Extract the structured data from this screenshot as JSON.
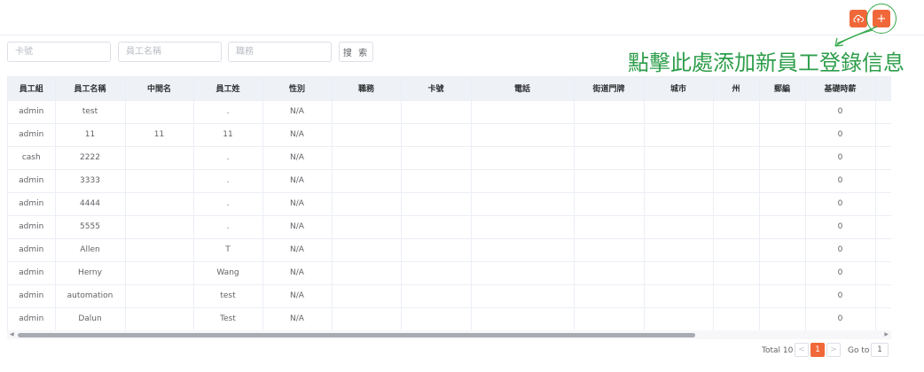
{
  "toolbar": {
    "upload_icon": "cloud-upload-icon",
    "add_label": "+",
    "accent": "#f0683a"
  },
  "annotation": {
    "text": "點擊此處添加新員工登錄信息",
    "color": "#2e9e4b"
  },
  "filters": {
    "card_placeholder": "卡號",
    "name_placeholder": "員工名稱",
    "job_placeholder": "職務",
    "search_label": "搜 索"
  },
  "table": {
    "columns": [
      "員工組",
      "員工名稱",
      "中間名",
      "員工姓",
      "性別",
      "職務",
      "卡號",
      "電話",
      "街道門牌",
      "城市",
      "州",
      "郵編",
      "基礎時薪"
    ],
    "rows": [
      [
        "admin",
        "test",
        "",
        ".",
        "N/A",
        "",
        "",
        "",
        "",
        "",
        "",
        "",
        "0"
      ],
      [
        "admin",
        "11",
        "11",
        "11",
        "N/A",
        "",
        "",
        "",
        "",
        "",
        "",
        "",
        "0"
      ],
      [
        "cash",
        "2222",
        "",
        ".",
        "N/A",
        "",
        "",
        "",
        "",
        "",
        "",
        "",
        "0"
      ],
      [
        "admin",
        "3333",
        "",
        ".",
        "N/A",
        "",
        "",
        "",
        "",
        "",
        "",
        "",
        "0"
      ],
      [
        "admin",
        "4444",
        "",
        ".",
        "N/A",
        "",
        "",
        "",
        "",
        "",
        "",
        "",
        "0"
      ],
      [
        "admin",
        "5555",
        "",
        ".",
        "N/A",
        "",
        "",
        "",
        "",
        "",
        "",
        "",
        "0"
      ],
      [
        "admin",
        "Allen",
        "",
        "T",
        "N/A",
        "",
        "",
        "",
        "",
        "",
        "",
        "",
        "0"
      ],
      [
        "admin",
        "Herny",
        "",
        "Wang",
        "N/A",
        "",
        "",
        "",
        "",
        "",
        "",
        "",
        "0"
      ],
      [
        "admin",
        "automation",
        "",
        "test",
        "N/A",
        "",
        "",
        "",
        "",
        "",
        "",
        "",
        "0"
      ],
      [
        "admin",
        "Dalun",
        "",
        "Test",
        "N/A",
        "",
        "",
        "",
        "",
        "",
        "",
        "",
        "0"
      ]
    ]
  },
  "pagination": {
    "total_label": "Total 10",
    "prev": "<",
    "current": "1",
    "next": ">",
    "goto_label": "Go to",
    "goto_value": "1"
  }
}
